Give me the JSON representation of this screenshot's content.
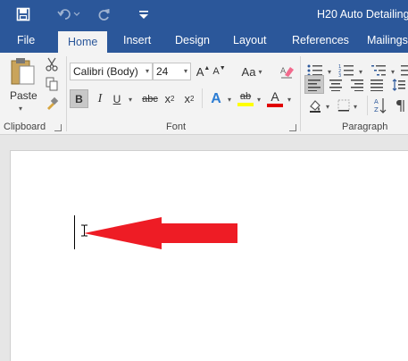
{
  "title_bar": {
    "document_title": "H20 Auto Detailing",
    "quick_access": [
      {
        "icon": "save-icon"
      },
      {
        "icon": "undo-icon"
      },
      {
        "icon": "redo-icon"
      },
      {
        "icon": "customize-toolbar-icon"
      }
    ]
  },
  "tabs": {
    "file": "File",
    "home": "Home",
    "insert": "Insert",
    "design": "Design",
    "layout": "Layout",
    "references": "References",
    "mailings": "Mailings",
    "active": "Home"
  },
  "ribbon": {
    "clipboard": {
      "label": "Clipboard",
      "paste": "Paste"
    },
    "font": {
      "label": "Font",
      "font_name": "Calibri (Body)",
      "font_size": "24",
      "bold": "B",
      "italic": "I",
      "underline": "U",
      "strikethrough": "abc",
      "subscript": "x",
      "subscript_mark": "2",
      "superscript": "x",
      "superscript_mark": "2",
      "change_case": "Aa",
      "grow_font": "A",
      "shrink_font": "A",
      "text_effects": "A",
      "highlight": "ab",
      "font_color": "A",
      "highlight_color": "#ffff00",
      "font_color_value": "#e00000"
    },
    "paragraph": {
      "label": "Paragraph"
    }
  },
  "colors": {
    "accent": "#2b579a",
    "arrow": "#ee1c25"
  }
}
